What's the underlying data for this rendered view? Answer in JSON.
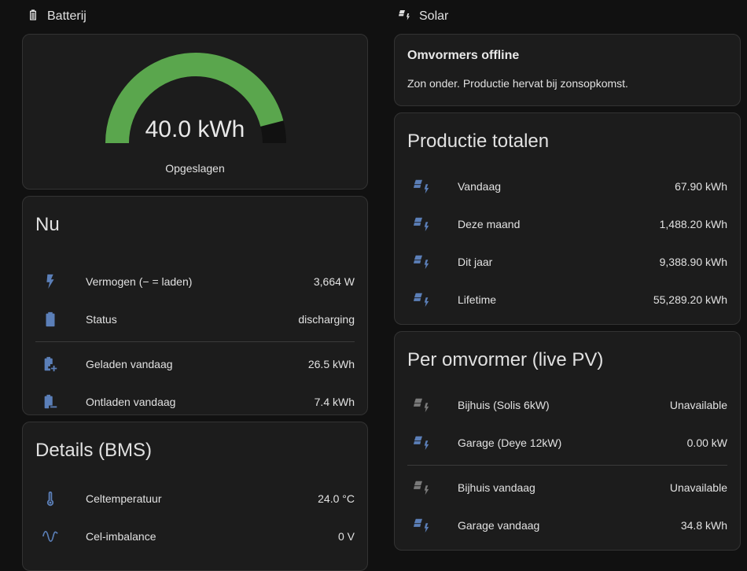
{
  "battery": {
    "section_title": "Batterij",
    "gauge": {
      "value_text": "40.0 kWh",
      "label": "Opgeslagen",
      "fraction": 0.92,
      "fill_color": "#5aa64d",
      "track_color": "#111111"
    },
    "now": {
      "title": "Nu",
      "rows": [
        {
          "label": "Vermogen (− = laden)",
          "value": "3,664 W",
          "icon": "flash-icon"
        },
        {
          "label": "Status",
          "value": "discharging",
          "icon": "battery-icon"
        },
        {
          "label": "Geladen vandaag",
          "value": "26.5 kWh",
          "icon": "battery-plus-icon"
        },
        {
          "label": "Ontladen vandaag",
          "value": "7.4 kWh",
          "icon": "battery-minus-icon"
        }
      ]
    },
    "details": {
      "title": "Details (BMS)",
      "rows": [
        {
          "label": "Celtemperatuur",
          "value": "24.0 °C",
          "icon": "thermometer-icon"
        },
        {
          "label": "Cel-imbalance",
          "value": "0 V",
          "icon": "sine-wave-icon"
        }
      ]
    }
  },
  "solar": {
    "section_title": "Solar",
    "offline": {
      "title": "Omvormers offline",
      "text": "Zon onder. Productie hervat bij zonsopkomst."
    },
    "totals": {
      "title": "Productie totalen",
      "rows": [
        {
          "label": "Vandaag",
          "value": "67.90 kWh",
          "icon": "solar-power-icon"
        },
        {
          "label": "Deze maand",
          "value": "1,488.20 kWh",
          "icon": "solar-power-icon"
        },
        {
          "label": "Dit jaar",
          "value": "9,388.90 kWh",
          "icon": "solar-power-icon"
        },
        {
          "label": "Lifetime",
          "value": "55,289.20 kWh",
          "icon": "solar-power-icon"
        }
      ]
    },
    "per_inverter": {
      "title": "Per omvormer (live PV)",
      "rows": [
        {
          "label": "Bijhuis (Solis 6kW)",
          "value": "Unavailable",
          "icon": "solar-power-icon"
        },
        {
          "label": "Garage (Deye 12kW)",
          "value": "0.00 kW",
          "icon": "solar-power-icon"
        },
        {
          "label": "Bijhuis vandaag",
          "value": "Unavailable",
          "icon": "solar-power-icon"
        },
        {
          "label": "Garage vandaag",
          "value": "34.8 kWh",
          "icon": "solar-power-icon"
        }
      ]
    }
  },
  "colors": {
    "icon_active": "#5b7fb8",
    "icon_inactive": "#7a7a7a"
  }
}
